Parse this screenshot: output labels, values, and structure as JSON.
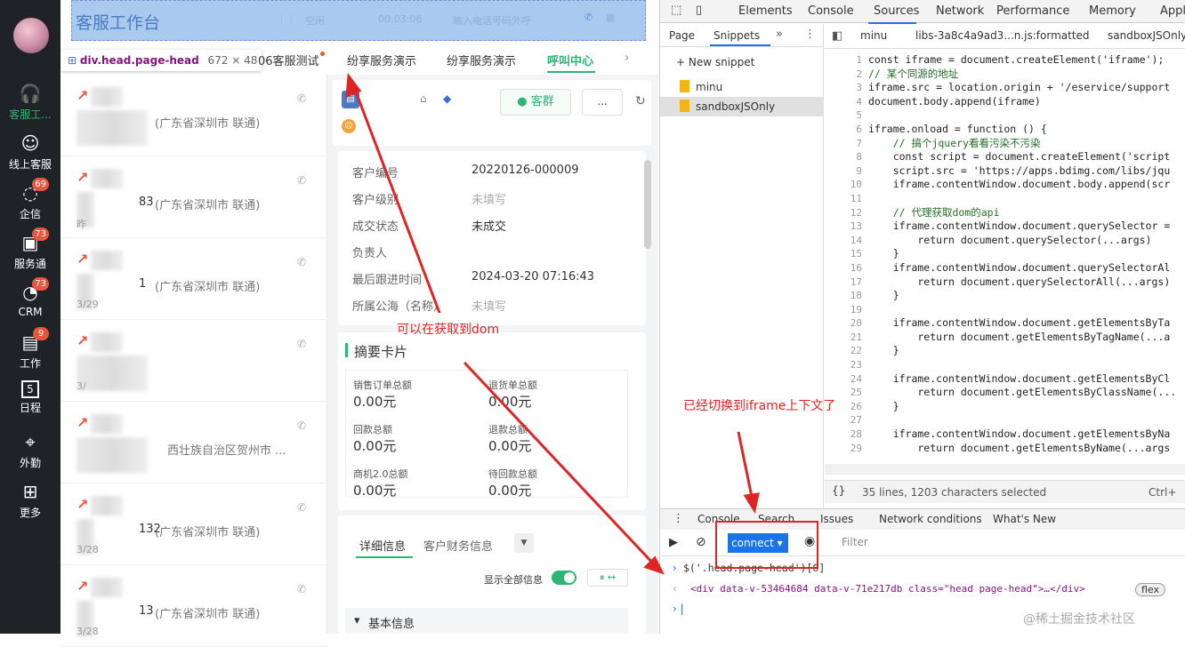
{
  "nav": {
    "items": [
      {
        "label": "客服工...",
        "icon": "headset-icon",
        "active": true
      },
      {
        "label": "线上客服",
        "icon": "smile-icon"
      },
      {
        "label": "企信",
        "icon": "chat-icon",
        "badge": "69"
      },
      {
        "label": "服务通",
        "icon": "service-icon",
        "badge": "73"
      },
      {
        "label": "CRM",
        "icon": "crm-icon",
        "badge": "73"
      },
      {
        "label": "工作",
        "icon": "briefcase-icon",
        "badge": "9"
      },
      {
        "label": "日程",
        "icon": "calendar-icon",
        "day": "5"
      },
      {
        "label": "外勤",
        "icon": "location-icon"
      },
      {
        "label": "更多",
        "icon": "grid-icon"
      }
    ]
  },
  "topbar": {
    "title": "客服工作台",
    "status": "空闲",
    "timer": "00:03:06",
    "phone_placeholder": "输入电话号码外呼"
  },
  "tooltip": {
    "selector": "div.head.page-head",
    "size": "672 × 48"
  },
  "tabs": [
    "06客服测试",
    "纷享服务演示",
    "纷享服务演示",
    "呼叫中心"
  ],
  "list": {
    "rows": [
      {
        "loc": "(广东省深圳市 联通)",
        "num": "",
        "date": ""
      },
      {
        "loc": "(广东省深圳市 联通)",
        "num": "83",
        "date": "昨"
      },
      {
        "loc": "(广东省深圳市 联通)",
        "num": "1",
        "date": "3/29"
      },
      {
        "loc": "",
        "num": "",
        "date": "3/"
      },
      {
        "loc": "西壮族自治区贺州市 ...",
        "num": "",
        "date": ""
      },
      {
        "loc": "(广东省深圳市 联通)",
        "num": "132",
        "date": "3/28"
      },
      {
        "loc": "(广东省深圳市 联通)",
        "num": "13",
        "date": "3/28"
      }
    ]
  },
  "customer": {
    "group_button": "客群",
    "more_button": "...",
    "fields": [
      {
        "label": "客户编号",
        "value": "20220126-000009"
      },
      {
        "label": "客户级别",
        "value": "未填写",
        "gray": true
      },
      {
        "label": "成交状态",
        "value": "未成交"
      },
      {
        "label": "负责人",
        "value": ""
      },
      {
        "label": "最后跟进时间",
        "value": "2024-03-20 07:16:43"
      },
      {
        "label": "所属公海（名称）",
        "value": "未填写",
        "gray": true
      }
    ]
  },
  "summary": {
    "title": "摘要卡片",
    "items": [
      {
        "label": "销售订单总额",
        "value": "0.00元"
      },
      {
        "label": "退货单总额",
        "value": "0.00元"
      },
      {
        "label": "回款总额",
        "value": "0.00元"
      },
      {
        "label": "退款总额",
        "value": "0.00元"
      },
      {
        "label": "商机2.0总额",
        "value": "0.00元"
      },
      {
        "label": "待回款总额",
        "value": "0.00元"
      }
    ]
  },
  "detail": {
    "tabs": [
      "详细信息",
      "客户财务信息"
    ],
    "show_all": "显示全部信息",
    "section": "基本信息"
  },
  "devtools": {
    "tabs": [
      "Elements",
      "Console",
      "Sources",
      "Network",
      "Performance",
      "Memory",
      "Applic"
    ],
    "nav_tabs": [
      "Page",
      "Snippets"
    ],
    "new_snippet": "+ New snippet",
    "snippets": [
      "minu",
      "sandboxJSOnly"
    ],
    "file_tabs": [
      "minu",
      "libs-3a8c4a9ad3...n.js:formatted",
      "sandboxJSOnly"
    ],
    "status": "35 lines, 1203 characters selected",
    "status_right": "Ctrl+",
    "drawer_tabs": [
      "Console",
      "Search",
      "Issues",
      "Network conditions",
      "What's New"
    ],
    "context": "connect",
    "filter_placeholder": "Filter",
    "console_input": "$('.head.page-head')[0]",
    "console_output": "<div data-v-53464684 data-v-71e217db class=\"head page-head\">…</div>",
    "flex_badge": "flex",
    "code_lines": [
      "const iframe = document.createElement('iframe');",
      "// 某个同源的地址",
      "iframe.src = location.origin + '/eservice/support",
      "document.body.append(iframe)",
      "",
      "iframe.onload = function () {",
      "    // 搞个jquery看看污染不污染",
      "    const script = document.createElement('script",
      "    script.src = 'https://apps.bdimg.com/libs/jqu",
      "    iframe.contentWindow.document.body.append(scr",
      "",
      "    // 代理获取dom的api",
      "    iframe.contentWindow.document.querySelector =",
      "        return document.querySelector(...args)",
      "    }",
      "    iframe.contentWindow.document.querySelectorAl",
      "        return document.querySelectorAll(...args)",
      "    }",
      "",
      "    iframe.contentWindow.document.getElementsByTa",
      "        return document.getElementsByTagName(...a",
      "    }",
      "",
      "    iframe.contentWindow.document.getElementsByCl",
      "        return document.getElementsByClassName(...",
      "    }",
      "",
      "    iframe.contentWindow.document.getElementsByNa",
      "        return document.getElementsByName(...args"
    ]
  },
  "annotations": {
    "a1": "可以在获取到dom",
    "a2": "已经切换到iframe上下文了"
  },
  "watermark": "@稀土掘金技术社区",
  "colors": {
    "nav_bg": "#1f2328",
    "accent": "#2bb673",
    "badge": "#e8553c",
    "annotation": "#e02424",
    "highlight": "#a9c9ef"
  }
}
